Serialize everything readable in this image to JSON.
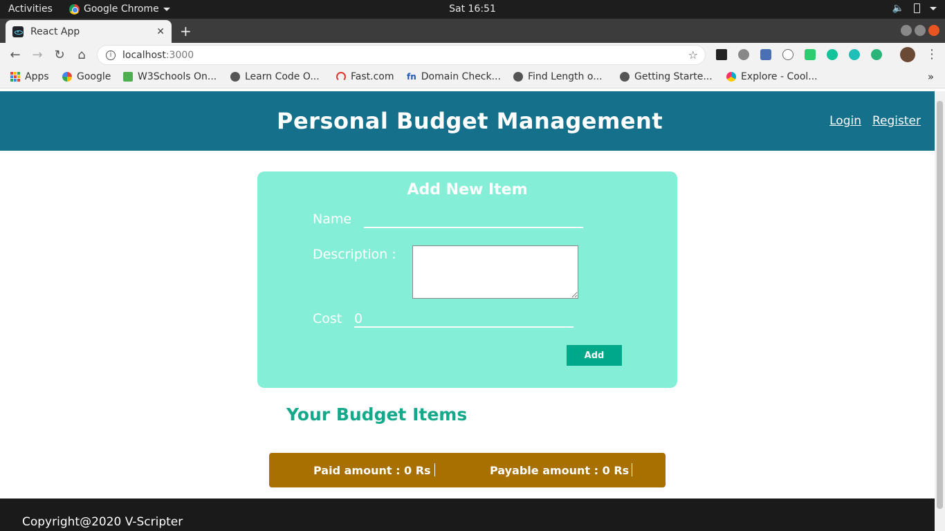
{
  "os_bar": {
    "activities": "Activities",
    "app_name": "Google Chrome",
    "clock": "Sat 16:51"
  },
  "browser": {
    "tab_title": "React App",
    "url_host": "localhost",
    "url_port": ":3000",
    "bookmarks": [
      {
        "label": "Apps",
        "icon": "apps-grid-icon"
      },
      {
        "label": "Google",
        "icon": "google-icon"
      },
      {
        "label": "W3Schools On...",
        "icon": "w3schools-icon"
      },
      {
        "label": "Learn Code O...",
        "icon": "globe-icon"
      },
      {
        "label": "Fast.com",
        "icon": "fast-icon"
      },
      {
        "label": "Domain Check...",
        "icon": "fn-icon"
      },
      {
        "label": "Find Length o...",
        "icon": "globe-icon"
      },
      {
        "label": "Getting Starte...",
        "icon": "globe-icon"
      },
      {
        "label": "Explore - Cool...",
        "icon": "coolors-icon"
      }
    ]
  },
  "header": {
    "title": "Personal Budget Management",
    "login": "Login",
    "register": "Register"
  },
  "form": {
    "title": "Add New Item",
    "name_label": "Name",
    "name_value": "",
    "description_label": "Description :",
    "description_value": "",
    "cost_label": "Cost",
    "cost_value": "0",
    "add_button": "Add"
  },
  "budget": {
    "heading": "Your Budget Items",
    "paid": "Paid amount : 0 Rs",
    "payable": "Payable amount : 0 Rs"
  },
  "footer": {
    "copyright": "Copyright@2020 V-Scripter"
  },
  "colors": {
    "header_bg": "#15708c",
    "card_bg": "#85eed6",
    "accent": "#16a88a",
    "summary_bg": "#a77000",
    "footer_bg": "#1a1a1a"
  }
}
